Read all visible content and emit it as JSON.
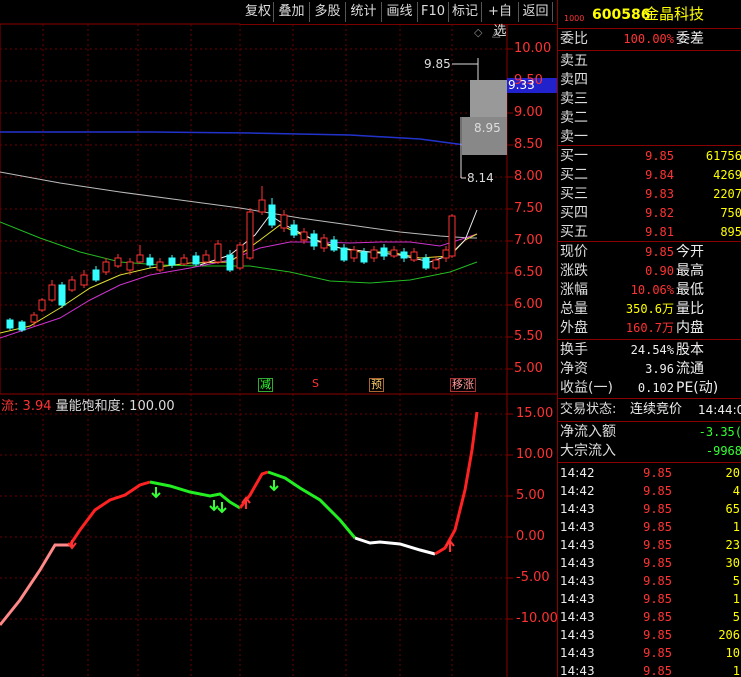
{
  "toolbar": {
    "buttons": [
      "复权",
      "叠加",
      "多股",
      "统计",
      "画线",
      "F10",
      "标记",
      "+自选",
      "返回"
    ]
  },
  "stock": {
    "code_small": "1000",
    "code": "600586",
    "name": "金晶科技"
  },
  "price_axis": [
    "10.00",
    "9.50",
    "9.00",
    "8.50",
    "8.00",
    "7.50",
    "7.00",
    "6.50",
    "6.00",
    "5.50",
    "5.00"
  ],
  "price_marks": {
    "high_label": "9.85",
    "current_box": "9.33",
    "mid_label": "8.95",
    "low_label": "8.14"
  },
  "signals": [
    "减",
    "S",
    "预",
    "移涨"
  ],
  "indicator": {
    "name": "流",
    "value": "3.94",
    "label": "量能饱和度:",
    "label_value": "100.00",
    "axis": [
      "15.00",
      "10.00",
      "5.00",
      "0.00",
      "-5.00",
      "-10.00"
    ]
  },
  "panel": {
    "weibi_label": "委比",
    "weibi_value": "100.00%",
    "weicha_label": "委差",
    "asks": [
      {
        "label": "卖五"
      },
      {
        "label": "卖四"
      },
      {
        "label": "卖三"
      },
      {
        "label": "卖二"
      },
      {
        "label": "卖一"
      }
    ],
    "bids": [
      {
        "label": "买一",
        "price": "9.85",
        "vol": "61756"
      },
      {
        "label": "买二",
        "price": "9.84",
        "vol": "4269"
      },
      {
        "label": "买三",
        "price": "9.83",
        "vol": "2207"
      },
      {
        "label": "买四",
        "price": "9.82",
        "vol": "750"
      },
      {
        "label": "买五",
        "price": "9.81",
        "vol": "895"
      }
    ],
    "quote": [
      {
        "l1": "现价",
        "v1": "9.85",
        "l2": "今开"
      },
      {
        "l1": "涨跌",
        "v1": "0.90",
        "l2": "最高"
      },
      {
        "l1": "涨幅",
        "v1": "10.06%",
        "l2": "最低"
      },
      {
        "l1": "总量",
        "v1": "350.6万",
        "l2": "量比"
      },
      {
        "l1": "外盘",
        "v1": "160.7万",
        "l2": "内盘"
      }
    ],
    "extra": [
      {
        "l1": "换手",
        "v1": "24.54%",
        "l2": "股本"
      },
      {
        "l1": "净资",
        "v1": "3.96",
        "l2": "流通"
      },
      {
        "l1": "收益(一)",
        "v1": "0.102",
        "l2": "PE(动)"
      }
    ],
    "status_label": "交易状态:",
    "status_value": "连续竞价",
    "status_time": "14:44:0",
    "netflow_label": "净流入额",
    "netflow_value": "-3.35(",
    "bigflow_label": "大宗流入",
    "bigflow_value": "-9968",
    "ticks": [
      {
        "t": "14:42",
        "p": "9.85",
        "v": "20"
      },
      {
        "t": "14:42",
        "p": "9.85",
        "v": "4"
      },
      {
        "t": "14:43",
        "p": "9.85",
        "v": "65"
      },
      {
        "t": "14:43",
        "p": "9.85",
        "v": "1"
      },
      {
        "t": "14:43",
        "p": "9.85",
        "v": "23"
      },
      {
        "t": "14:43",
        "p": "9.85",
        "v": "30"
      },
      {
        "t": "14:43",
        "p": "9.85",
        "v": "5"
      },
      {
        "t": "14:43",
        "p": "9.85",
        "v": "1"
      },
      {
        "t": "14:43",
        "p": "9.85",
        "v": "5"
      },
      {
        "t": "14:43",
        "p": "9.85",
        "v": "206"
      },
      {
        "t": "14:43",
        "p": "9.85",
        "v": "10"
      },
      {
        "t": "14:43",
        "p": "9.85",
        "v": "1"
      }
    ]
  },
  "colors": {
    "up": "#ff3333",
    "down": "#33ffff",
    "grid": "#8b0000",
    "ma_blue": "#2233cc"
  }
}
